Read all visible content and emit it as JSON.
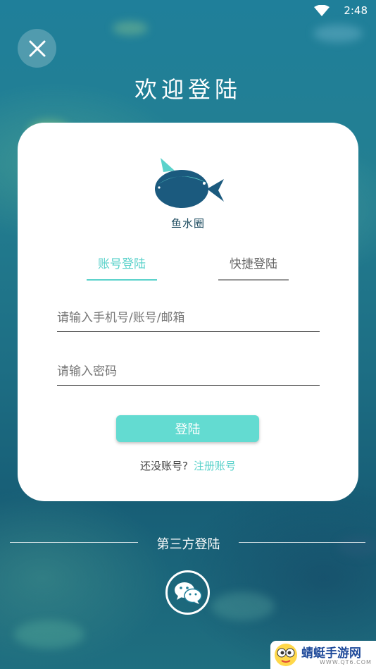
{
  "status_bar": {
    "time": "2:48",
    "wifi_icon": "wifi-icon"
  },
  "header": {
    "close_icon": "close-icon",
    "title": "欢迎登陆"
  },
  "card": {
    "logo_icon": "fish-logo-icon",
    "app_name": "鱼水圈",
    "tabs": [
      {
        "label": "账号登陆",
        "active": true
      },
      {
        "label": "快捷登陆",
        "active": false
      }
    ],
    "account_field": {
      "placeholder": "请输入手机号/账号/邮箱",
      "value": ""
    },
    "password_field": {
      "placeholder": "请输入密码",
      "value": ""
    },
    "login_button": "登陆",
    "register_prompt": "还没账号?",
    "register_link": "注册账号"
  },
  "third_party": {
    "label": "第三方登陆",
    "wechat_icon": "wechat-icon"
  },
  "watermark": {
    "text": "蜻蜓手游网",
    "url": "WWW.QT6.COM"
  },
  "colors": {
    "accent": "#5bd2cb",
    "button": "#63dbd1",
    "background": "#1f7f9a",
    "logo": "#1b5a7e"
  }
}
